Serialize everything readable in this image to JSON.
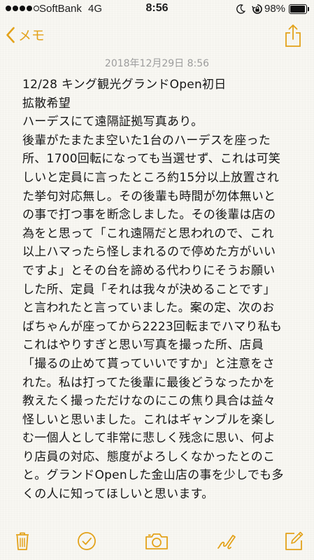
{
  "status_bar": {
    "carrier": "SoftBank",
    "network": "4G",
    "time": "8:56",
    "battery_percent": "98%",
    "signal_bars": 4,
    "signal_total": 5
  },
  "nav": {
    "back_label": "メモ"
  },
  "note": {
    "date": "2018年12月29日 8:56",
    "lines": [
      "12/28 キング観光グランドOpen初日",
      "拡散希望",
      "ハーデスにて遠隔証拠写真あり。",
      "後輩がたまたま空いた1台のハーデスを座った",
      "所、1700回転になっても当選せず、これは可笑",
      "しいと定員に言ったところ約15分以上放置され",
      "た挙句対応無し。その後輩も時間が勿体無いと",
      "の事で打つ事を断念しました。その後輩は店の",
      "為をと思って「これ遠隔だと思われので、これ",
      "以上ハマったら怪しまれるので停めた方がいい",
      "ですよ」とその台を諦める代わりにそうお願い",
      "した所、定員「それは我々が決めることです」",
      "と言われたと言っていました。案の定、次のお",
      "ばちゃんが座ってから2223回転までハマり私も",
      "これはやりすぎと思い写真を撮った所、店員",
      "「撮るの止めて貰っていいですか」と注意をさ",
      "れた。私は打ってた後輩に最後どうなったかを",
      "教えたく撮っただけなのにこの焦り具合は益々",
      "怪しいと思いました。これはギャンブルを楽し",
      "む一個人として非常に悲しく残念に思い、何よ",
      "り店員の対応、態度がよろしくなかったとのこ",
      "と。グランドOpenした金山店の事を少しでも多",
      "くの人に知ってほしいと思います。"
    ]
  },
  "toolbar": {
    "items": [
      "trash-icon",
      "checklist-icon",
      "camera-icon",
      "sketch-icon",
      "compose-icon"
    ]
  },
  "colors": {
    "accent": "#e3a21a",
    "background": "#f8f7f2",
    "date_text": "#9c9c9c",
    "body_text": "#161616"
  }
}
